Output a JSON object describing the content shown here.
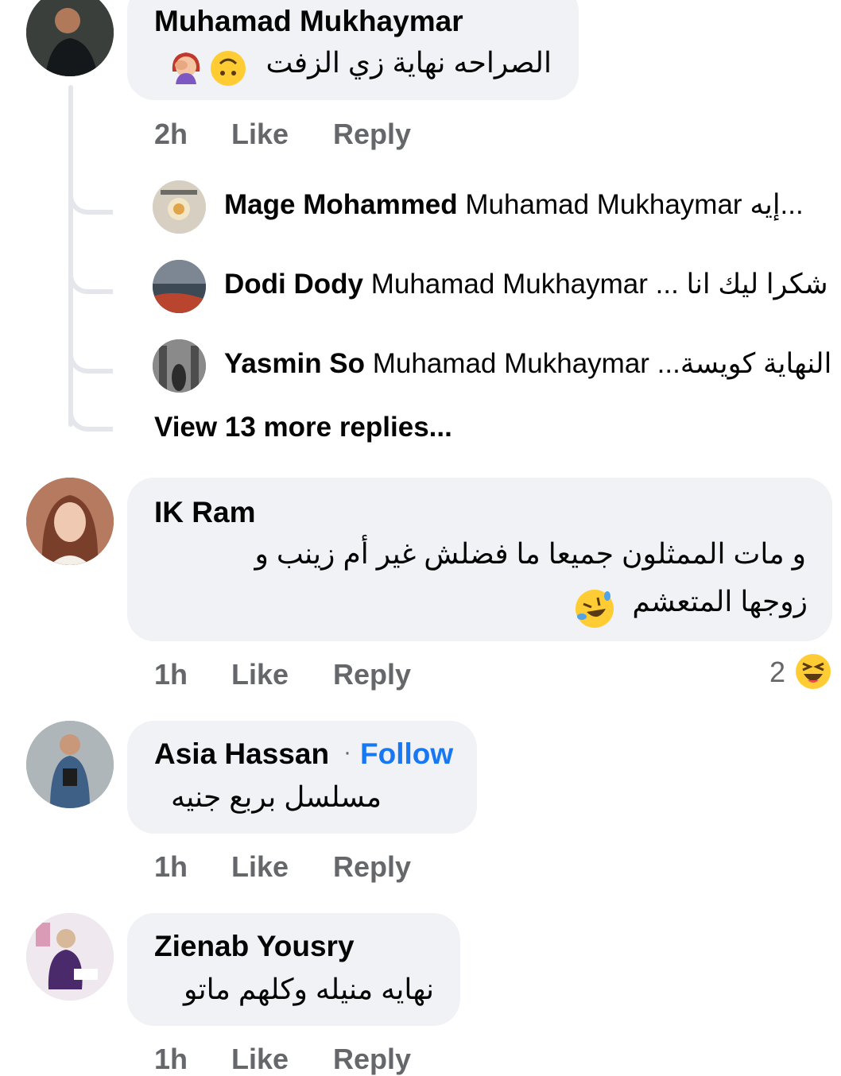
{
  "comments": [
    {
      "author": "Muhamad Mukhaymar",
      "text": "الصراحه نهاية زي الزفت",
      "time": "2h",
      "like_label": "Like",
      "reply_label": "Reply",
      "emoji_icons": [
        "upside-down-face-icon",
        "facepalm-woman-icon"
      ],
      "replies": [
        {
          "author": "Mage Mohammed",
          "text": "Muhamad Mukhaymar إيه..."
        },
        {
          "author": "Dodi Dody",
          "text": "Muhamad Mukhaymar ... شكرا ليك انا"
        },
        {
          "author": "Yasmin So",
          "text": "Muhamad Mukhaymar ...النهاية كويسة"
        }
      ],
      "view_more_label": "View 13 more replies..."
    },
    {
      "author": "IK Ram",
      "text_line1": "و مات الممثلون جميعا ما فضلش غير أم زينب و",
      "text_line2": "زوجها المتعشم",
      "time": "1h",
      "like_label": "Like",
      "reply_label": "Reply",
      "reaction_count": "2",
      "reaction_icon": "laughing-squint-icon",
      "emoji_icons": [
        "rolling-laughing-icon"
      ]
    },
    {
      "author": "Asia Hassan",
      "separator": "·",
      "follow_label": "Follow",
      "text": "مسلسل بربع جنيه",
      "time": "1h",
      "like_label": "Like",
      "reply_label": "Reply"
    },
    {
      "author": "Zienab Yousry",
      "text": "نهايه منيله وكلهم ماتو",
      "time": "1h",
      "like_label": "Like",
      "reply_label": "Reply"
    }
  ],
  "colors": {
    "bubble": "#f0f2f5",
    "meta": "#65676b",
    "follow": "#1877f2",
    "text": "#050505"
  }
}
